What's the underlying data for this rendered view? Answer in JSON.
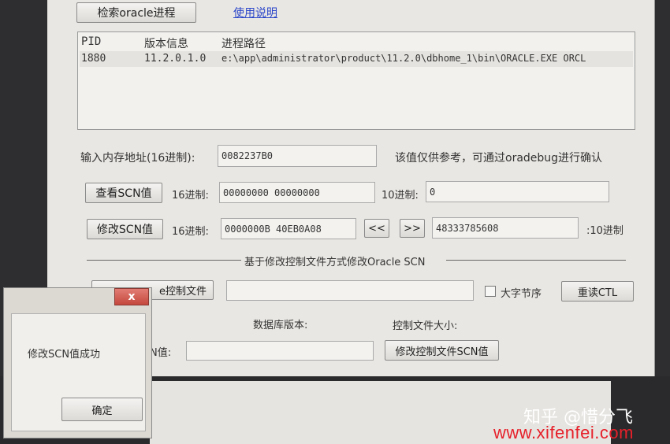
{
  "toolbar": {
    "search_button": "检索oracle进程",
    "help_link": "使用说明"
  },
  "process_list": {
    "columns": [
      "PID",
      "版本信息",
      "进程路径"
    ],
    "rows": [
      {
        "pid": "1880",
        "version": "11.2.0.1.0",
        "path": "e:\\app\\administrator\\product\\11.2.0\\dbhome_1\\bin\\ORACLE.EXE ORCL"
      }
    ]
  },
  "memory": {
    "label": "输入内存地址(16进制):",
    "value": "0082237B0",
    "hint": "该值仅供参考，可通过oradebug进行确认"
  },
  "view_scn": {
    "button": "查看SCN值",
    "hex_label": "16进制:",
    "hex_value": "00000000 00000000",
    "dec_label": "10进制:",
    "dec_value": "0"
  },
  "modify_scn": {
    "button": "修改SCN值",
    "hex_label": "16进制:",
    "hex_value": "0000000B 40EB0A08",
    "left_arrows": "<<",
    "right_arrows": ">>",
    "dec_value": "48333785608",
    "dec_label": ":10进制"
  },
  "section": {
    "title": "基于修改控制文件方式修改Oracle SCN"
  },
  "control_file": {
    "button_partial": "e控制文件",
    "path_value": "",
    "big_endian_label": "大字节序",
    "big_endian_checked": false,
    "reread_button": "重读CTL",
    "db_version_label": "数据库版本:",
    "ctl_size_label": "控制文件大小:",
    "scn_label_partial": "N值:",
    "scn_value": "",
    "modify_button": "修改控制文件SCN值"
  },
  "dialog": {
    "close_label": "x",
    "message": "修改SCN值成功",
    "ok_button": "确定"
  },
  "watermark": {
    "zh": "知乎 @惜分飞",
    "url": "www.xifenfei.com"
  }
}
